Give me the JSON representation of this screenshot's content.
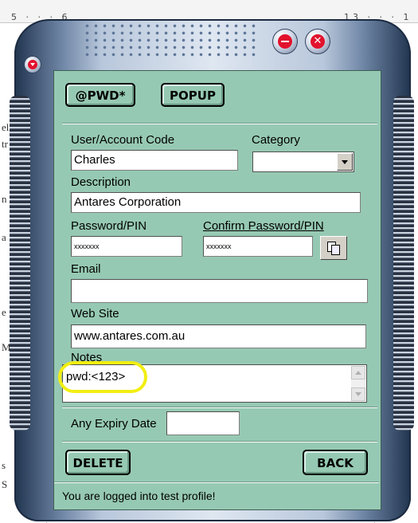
{
  "background": {
    "ruler_left": "5 · · · 6",
    "ruler_right": "13 · · · 1",
    "margin_letters": [
      "el",
      "tr",
      "n",
      "a",
      "e",
      "M",
      "s",
      "S"
    ]
  },
  "window": {
    "menu_icon": "chevron-down-icon",
    "minimize_icon": "minimize-icon",
    "close_icon": "close-icon",
    "close_glyph": "✕"
  },
  "toolbar": {
    "pwd_label": "@PWD*",
    "popup_label": "POPUP"
  },
  "form": {
    "user_label": "User/Account Code",
    "user_value": "Charles",
    "category_label": "Category",
    "category_value": "",
    "description_label": "Description",
    "description_value": "Antares Corporation",
    "password_label": "Password/PIN",
    "password_value": "xxxxxxx",
    "confirm_label": "Confirm Password/PIN",
    "confirm_value": "xxxxxxx",
    "email_label": "Email",
    "email_value": "",
    "website_label": "Web Site",
    "website_value": "www.antares.com.au",
    "notes_label": "Notes",
    "notes_value": "pwd:<123>",
    "expiry_label": "Any Expiry Date",
    "expiry_value": ""
  },
  "actions": {
    "delete_label": "DELETE",
    "back_label": "BACK"
  },
  "status": {
    "text": "You are logged into test profile!"
  },
  "colors": {
    "panel": "#96c9b3",
    "highlight": "#f2ee12",
    "close_red": "#e2122d"
  }
}
